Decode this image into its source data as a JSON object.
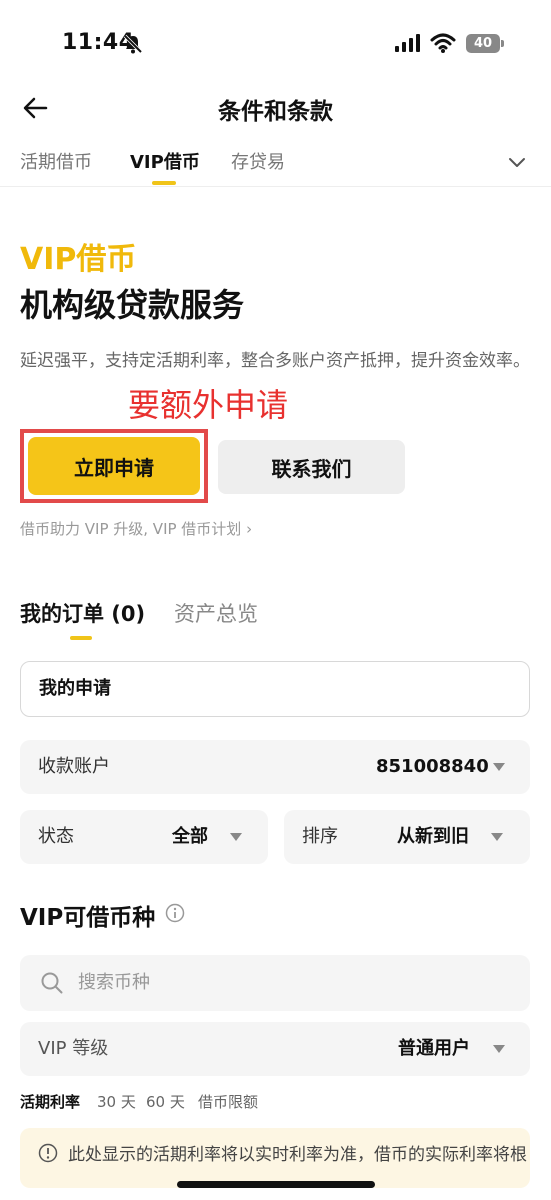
{
  "status_bar": {
    "time": "11:44",
    "battery": "40"
  },
  "header": {
    "title": "条件和条款"
  },
  "top_tabs": [
    {
      "label": "活期借币"
    },
    {
      "label": "VIP借币"
    },
    {
      "label": "存贷易"
    }
  ],
  "hero": {
    "subtitle": "VIP借币",
    "title": "机构级贷款服务",
    "description": "延迟强平，支持定活期利率，整合多账户资产抵押，提升资金效率。",
    "annotation": "要额外申请",
    "apply_button": "立即申请",
    "contact_button": "联系我们",
    "plan_link": "借币助力 VIP 升级, VIP 借币计划 ›"
  },
  "orders": {
    "tab_orders": "我的订单 (0)",
    "tab_assets": "资产总览",
    "my_application": "我的申请",
    "account_label": "收款账户",
    "account_value": "851008840",
    "status_label": "状态",
    "status_value": "全部",
    "sort_label": "排序",
    "sort_value": "从新到旧"
  },
  "vip_coins": {
    "title": "VIP可借币种",
    "search_placeholder": "搜索币种",
    "level_label": "VIP 等级",
    "level_value": "普通用户",
    "rate_tabs": [
      "活期利率",
      "30 天",
      "60 天",
      "借币限额"
    ],
    "notice": "此处显示的活期利率将以实时利率为准，借币的实际利率将根"
  },
  "colors": {
    "accent": "#f5c518",
    "annotation": "#e8312f",
    "highlight_box": "#e24a4a"
  }
}
